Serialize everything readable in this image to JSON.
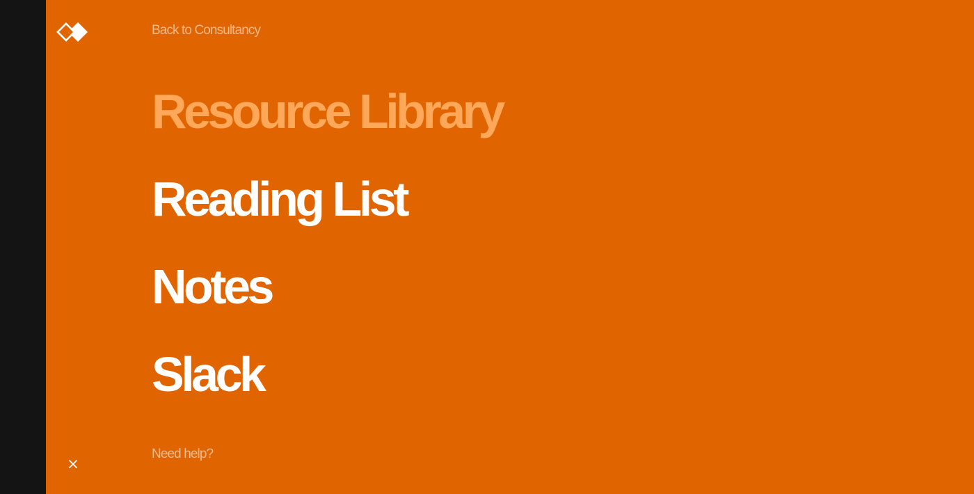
{
  "colors": {
    "background": "#e06400",
    "left_strip": "#141414",
    "active_item": "#ffa85a",
    "text": "#ffffff"
  },
  "header": {
    "logo_icon": "double-diamond-logo",
    "back_link": "Back to Consultancy"
  },
  "nav": {
    "items": [
      {
        "label": "Resource Library",
        "active": true
      },
      {
        "label": "Reading List",
        "active": false
      },
      {
        "label": "Notes",
        "active": false
      },
      {
        "label": "Slack",
        "active": false
      }
    ]
  },
  "footer": {
    "help_link": "Need help?",
    "close_icon": "close-icon"
  }
}
